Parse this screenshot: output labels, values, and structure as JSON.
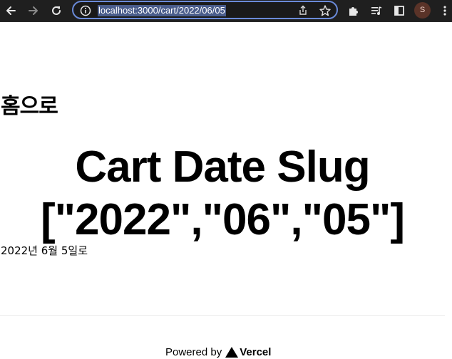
{
  "browser": {
    "url": "localhost:3000/cart/2022/06/05",
    "profile_initial": "S",
    "icons": {
      "back": "arrow-left-icon",
      "forward": "arrow-right-icon",
      "reload": "reload-icon",
      "site_info": "info-icon",
      "share": "share-icon",
      "bookmark": "star-icon",
      "extensions": "puzzle-icon",
      "media": "media-queue-icon",
      "side_panel": "side-panel-icon",
      "menu": "kebab-menu-icon"
    }
  },
  "page": {
    "home_link": "홈으로",
    "title": "Cart Date Slug [\"2022\",\"06\",\"05\"]",
    "date_text": "2022년 6월 5일로"
  },
  "footer": {
    "powered_by": "Powered by",
    "brand": "Vercel"
  },
  "colors": {
    "toolbar_bg": "#1f1f1f",
    "omnibox_focus": "#6a8ad8",
    "url_selection": "#4a5d8c",
    "page_bg": "#ffffff",
    "text": "#000000",
    "divider": "#eaeaea"
  }
}
